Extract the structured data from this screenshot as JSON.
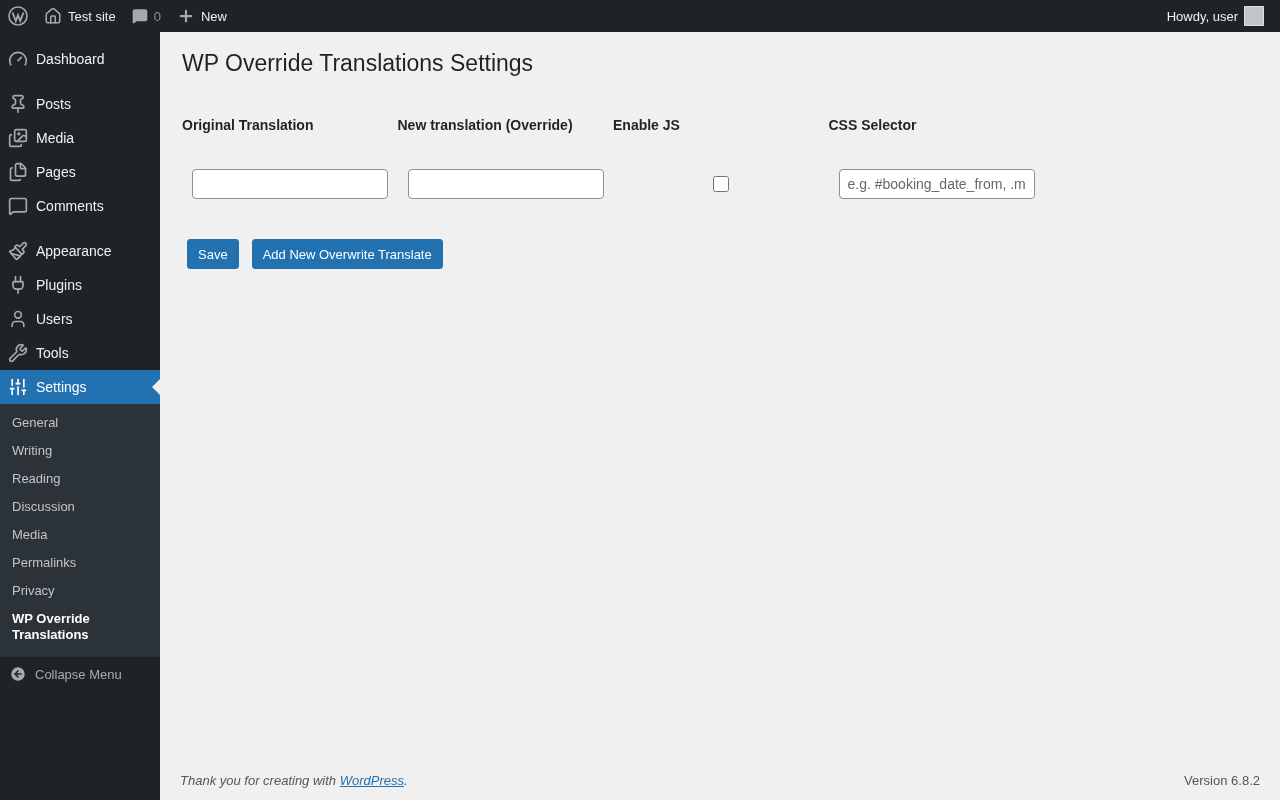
{
  "admin_bar": {
    "site_name": "Test site",
    "comments_count": "0",
    "new_label": "New",
    "greeting": "Howdy, user"
  },
  "sidebar": {
    "groups": [
      [
        {
          "label": "Dashboard",
          "selected": false
        }
      ],
      [
        {
          "label": "Posts",
          "selected": false
        },
        {
          "label": "Media",
          "selected": false
        },
        {
          "label": "Pages",
          "selected": false
        },
        {
          "label": "Comments",
          "selected": false
        }
      ],
      [
        {
          "label": "Appearance",
          "selected": false
        },
        {
          "label": "Plugins",
          "selected": false
        },
        {
          "label": "Users",
          "selected": false
        },
        {
          "label": "Tools",
          "selected": false
        },
        {
          "label": "Settings",
          "selected": true
        }
      ]
    ],
    "submenu": [
      {
        "label": "General",
        "selected": false
      },
      {
        "label": "Writing",
        "selected": false
      },
      {
        "label": "Reading",
        "selected": false
      },
      {
        "label": "Discussion",
        "selected": false
      },
      {
        "label": "Media",
        "selected": false
      },
      {
        "label": "Permalinks",
        "selected": false
      },
      {
        "label": "Privacy",
        "selected": false
      },
      {
        "label": "WP Override Translations",
        "selected": true
      }
    ],
    "collapse_label": "Collapse Menu"
  },
  "page": {
    "title": "WP Override Translations Settings",
    "table": {
      "columns": [
        "Original Translation",
        "New translation (Override)",
        "Enable JS",
        "CSS Selector"
      ],
      "rows": [
        {
          "enable_js": {
            "checked": false
          },
          "css_selector": {
            "placeholder": "e.g. #booking_date_from, .m"
          }
        }
      ]
    },
    "buttons": [
      "Save",
      "Add New Overwrite Translate"
    ]
  },
  "footer": {
    "text_before": "Thank you for creating with ",
    "link": "WordPress",
    "text_after": ".",
    "version": "Version 6.8.2"
  }
}
